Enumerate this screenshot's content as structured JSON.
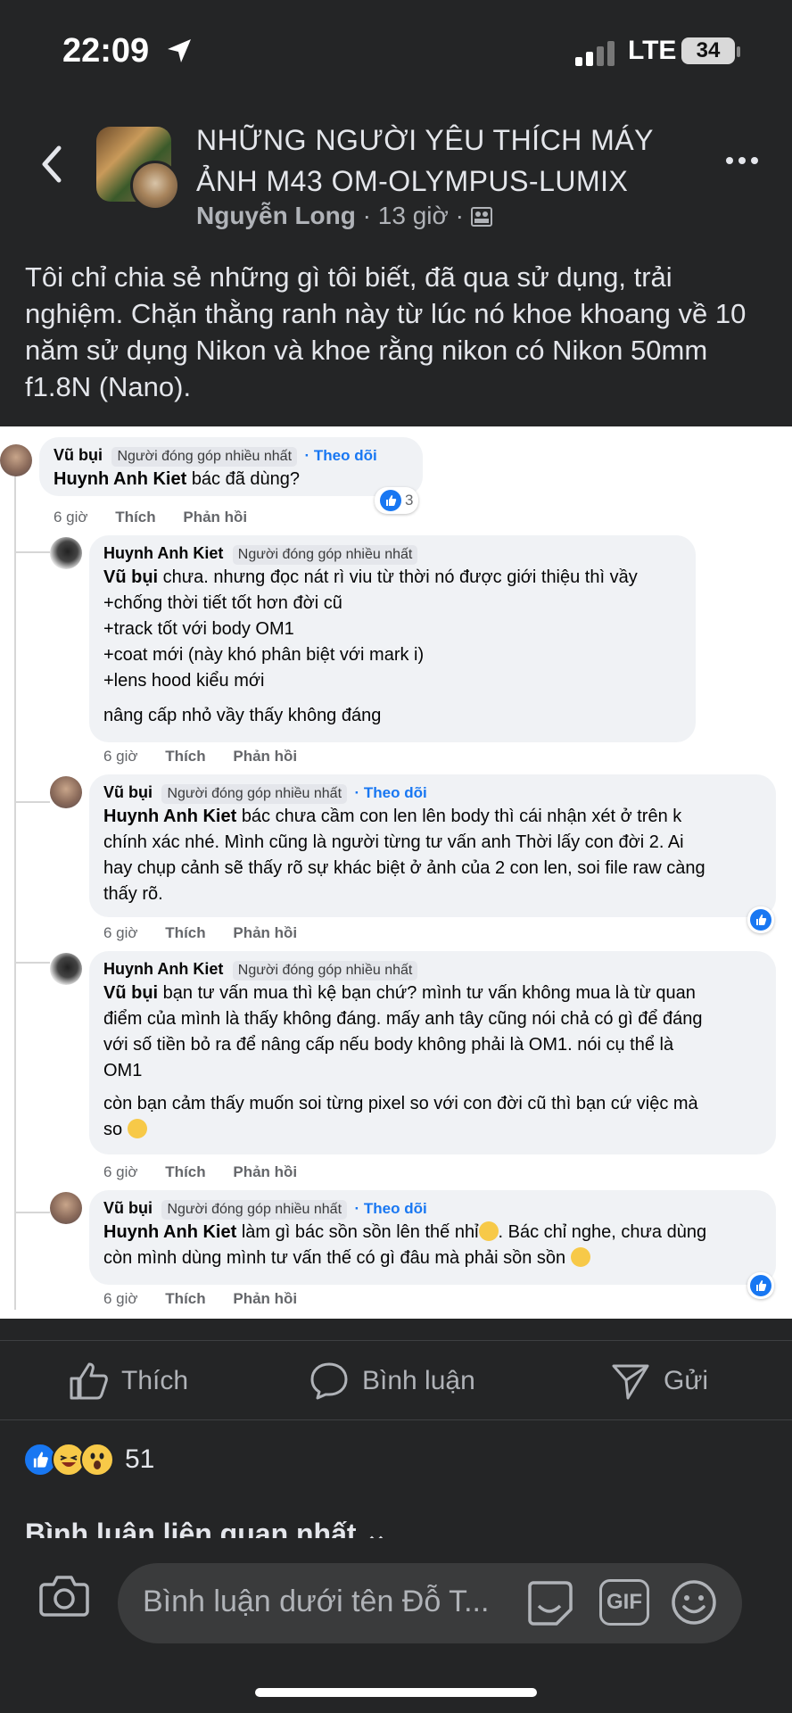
{
  "status": {
    "time": "22:09",
    "network": "LTE",
    "battery": "34"
  },
  "header": {
    "group_title": "NHỮNG NGƯỜI YÊU THÍCH MÁY ẢNH M43 OM-OLYMPUS-LUMIX",
    "author": "Nguyễn Long",
    "time": "13 giờ",
    "separator": "·"
  },
  "post": {
    "text": "Tôi chỉ chia sẻ những gì tôi biết, đã qua sử dụng, trải nghiệm. Chặn thằng ranh này từ lúc nó khoe khoang về 10 năm sử dụng Nikon và khoe rằng nikon có Nikon 50mm f1.8N (Nano)."
  },
  "comments": [
    {
      "name": "Vũ bụi",
      "badge": "Người đóng góp nhiều nhất",
      "follow": "Theo dõi",
      "mention": "Huynh Anh Kiet",
      "lines": [
        "bác đã dùng?"
      ],
      "time": "6 giờ",
      "like": "Thích",
      "reply": "Phản hồi",
      "reactions": "3"
    },
    {
      "name": "Huynh Anh Kiet",
      "badge": "Người đóng góp nhiều nhất",
      "mention": "Vũ bụi",
      "lines": [
        "chưa. nhưng đọc nát rì viu từ thời nó được giới thiệu thì vầy",
        "+chống thời tiết tốt hơn đời cũ",
        "+track tốt với body OM1",
        "+coat mới (này khó phân biệt với mark i)",
        "+lens hood kiểu mới",
        "nâng cấp nhỏ vầy thấy không đáng"
      ],
      "time": "6 giờ",
      "like": "Thích",
      "reply": "Phản hồi"
    },
    {
      "name": "Vũ bụi",
      "badge": "Người đóng góp nhiều nhất",
      "follow": "Theo dõi",
      "mention": "Huynh Anh Kiet",
      "lines": [
        "bác chưa cầm con len lên body thì cái nhận xét ở trên k",
        "chính xác nhé. Mình cũng là người từng tư vấn anh Thời lấy con đời 2. Ai",
        "hay chụp cảnh sẽ thấy rõ sự khác biệt ở ảnh của 2 con len, soi file raw càng",
        "thấy rõ."
      ],
      "time": "6 giờ",
      "like": "Thích",
      "reply": "Phản hồi"
    },
    {
      "name": "Huynh Anh Kiet",
      "badge": "Người đóng góp nhiều nhất",
      "mention": "Vũ bụi",
      "lines": [
        "bạn tư vấn mua thì kệ bạn chứ? mình tư vấn không mua là từ quan",
        "điểm của mình là thấy không đáng. mấy anh tây cũng nói chả có gì để đáng",
        "với số tiền bỏ ra để nâng cấp nếu body không phải là OM1. nói cụ thể là",
        "OM1",
        "còn bạn cảm thấy muốn soi từng pixel so với con đời cũ thì bạn cứ việc mà",
        "so"
      ],
      "time": "6 giờ",
      "like": "Thích",
      "reply": "Phản hồi"
    },
    {
      "name": "Vũ bụi",
      "badge": "Người đóng góp nhiều nhất",
      "follow": "Theo dõi",
      "mention": "Huynh Anh Kiet",
      "lines": [
        "làm gì bác sồn sồn lên thế nhỉ",
        ". Bác chỉ nghe, chưa dùng",
        "còn mình dùng mình tư vấn thế có gì đâu mà phải sồn sồn"
      ],
      "time": "6 giờ",
      "like": "Thích",
      "reply": "Phản hồi"
    }
  ],
  "actions": {
    "like": "Thích",
    "comment": "Bình luận",
    "share": "Gửi"
  },
  "reactions": {
    "count": "51"
  },
  "sort": {
    "label": "Bình luận liên quan nhất"
  },
  "composer": {
    "placeholder": "Bình luận dưới tên Đỗ T...",
    "gif": "GIF"
  },
  "colors": {
    "background": "#242526",
    "accent": "#1877f2",
    "bubble": "#f0f2f5"
  }
}
